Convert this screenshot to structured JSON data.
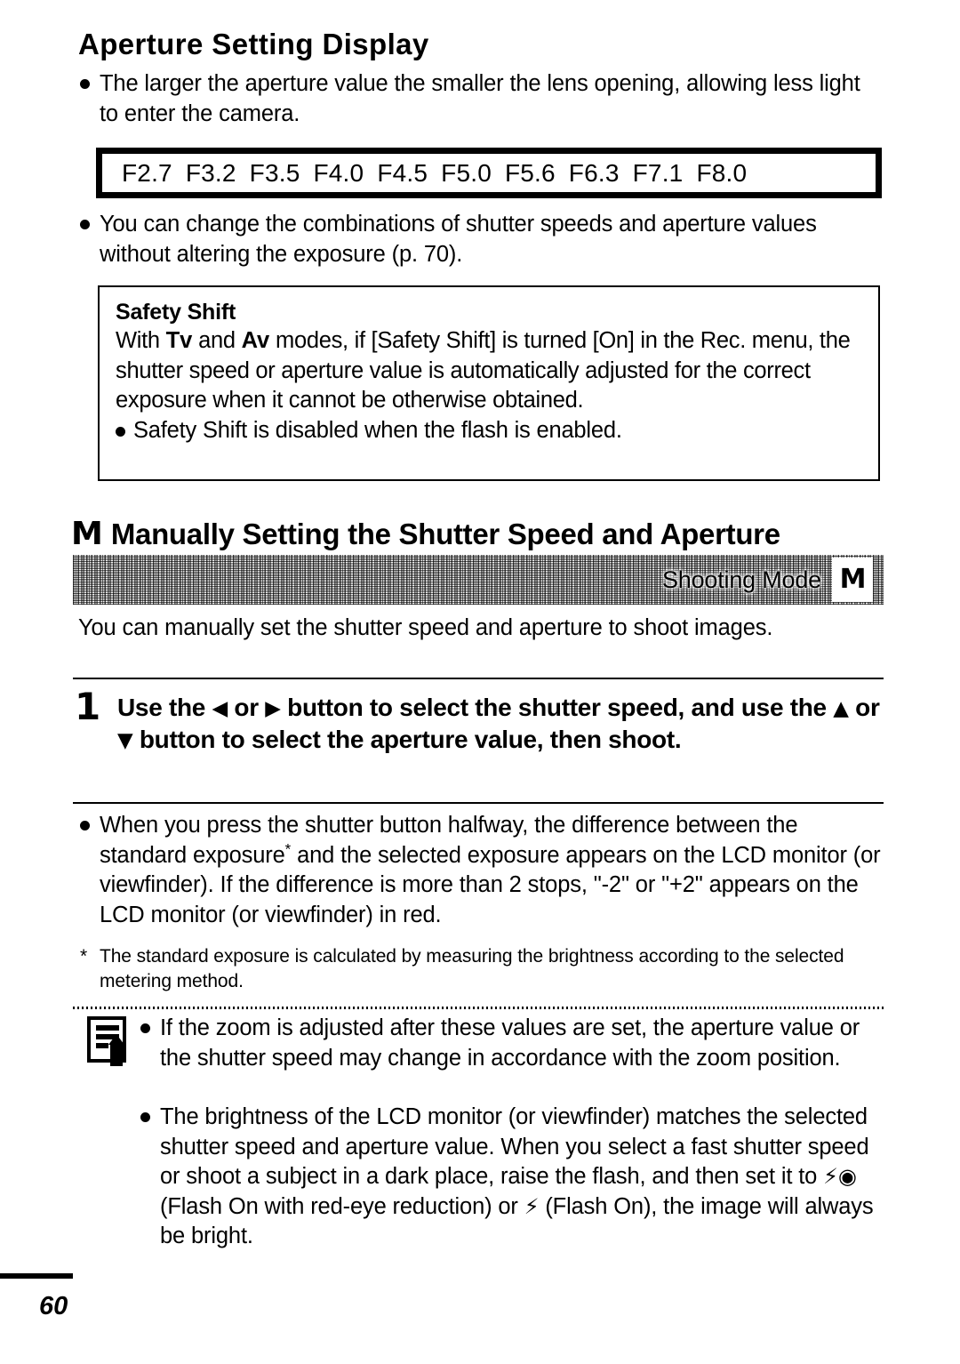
{
  "document": {
    "page_number": "60"
  },
  "section_aperture": {
    "heading": "Aperture Setting Display",
    "bullet_1": "The larger the aperture value the smaller the lens opening, allowing less light to enter the camera.",
    "aperture_values": [
      "F2.7",
      "F3.2",
      "F3.5",
      "F4.0",
      "F4.5",
      "F5.0",
      "F5.6",
      "F6.3",
      "F7.1",
      "F8.0"
    ],
    "bullet_2": "You can change the combinations of shutter speeds and aperture values without altering the exposure (p. 70)."
  },
  "safety_shift": {
    "title": "Safety Shift",
    "body_prefix": "With ",
    "mode_tv": "Tv",
    "body_mid": " and ",
    "mode_av": "Av",
    "body_suffix": " modes, if [Safety Shift] is turned [On] in the Rec. menu, the shutter speed or aperture value is automatically adjusted for the correct exposure when it cannot be otherwise obtained.",
    "sub_bullet": "Safety Shift is disabled when the flash is enabled."
  },
  "section_manual": {
    "mode_icon": "M",
    "heading": "Manually Setting the Shutter Speed and Aperture",
    "mode_bar": {
      "label": "Shooting Mode",
      "mode": "M"
    },
    "intro": "You can manually set the shutter speed and aperture to shoot images.",
    "step_number": "1",
    "step_text_part1": "Use the ",
    "step_arrow_left": "◀",
    "step_text_part2": " or ",
    "step_arrow_right": "▶",
    "step_text_part3": " button to select the shutter speed, and use the ",
    "step_arrow_up": "▲",
    "step_text_part4": " or ",
    "step_arrow_down": "▼",
    "step_text_part5": " button to select the aperture value, then shoot.",
    "bullet_exposure_a": "When you press the shutter button halfway, the difference between the standard exposure",
    "bullet_exposure_star": "*",
    "bullet_exposure_b": " and the selected exposure appears on the LCD monitor (or viewfinder). If the difference is more than 2 stops, \"-2\" or \"+2\" appears on the LCD monitor (or viewfinder) in red.",
    "footnote_marker": "*",
    "footnote_text": "The standard exposure is calculated by measuring the brightness according to the selected metering method."
  },
  "memo_notes": {
    "icon": "memo-pencil-icon",
    "note_1": "If the zoom is adjusted after these values are set, the aperture value or the shutter speed may change in accordance with the zoom position.",
    "note_2_part1": "The brightness of the LCD monitor (or viewfinder) matches the selected shutter speed and aperture value. When you select a fast shutter speed or shoot a subject in a dark place, raise the flash, and then set it to ",
    "note_2_flash_redeye": "⚡◉",
    "note_2_part2": " (Flash On with red-eye reduction) or ",
    "note_2_flash_on": "⚡",
    "note_2_part3": " (Flash On), the image will always be bright."
  }
}
